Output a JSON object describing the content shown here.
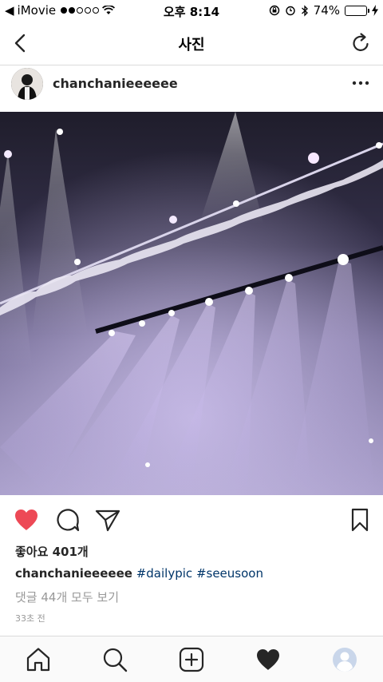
{
  "status_bar": {
    "carrier": "iMovie",
    "time": "오후 8:14",
    "battery_percent": "74%",
    "battery_level": 0.74
  },
  "nav": {
    "title": "사진"
  },
  "post": {
    "username": "chanchanieeeeee",
    "likes": "좋아요 401개",
    "caption_user": "chanchanieeeeee",
    "hashtags": [
      "#dailypic",
      "#seeusoon"
    ],
    "view_comments": "댓글 44개 모두 보기",
    "time_ago": "33초 전"
  },
  "colors": {
    "like_red": "#ed4956",
    "hashtag_blue": "#003569",
    "muted_gray": "#999999"
  },
  "icons": [
    "back-chevron-icon",
    "refresh-icon",
    "more-icon",
    "heart-icon",
    "comment-icon",
    "share-icon",
    "bookmark-icon",
    "home-icon",
    "search-icon",
    "add-icon",
    "activity-heart-icon",
    "profile-icon"
  ]
}
